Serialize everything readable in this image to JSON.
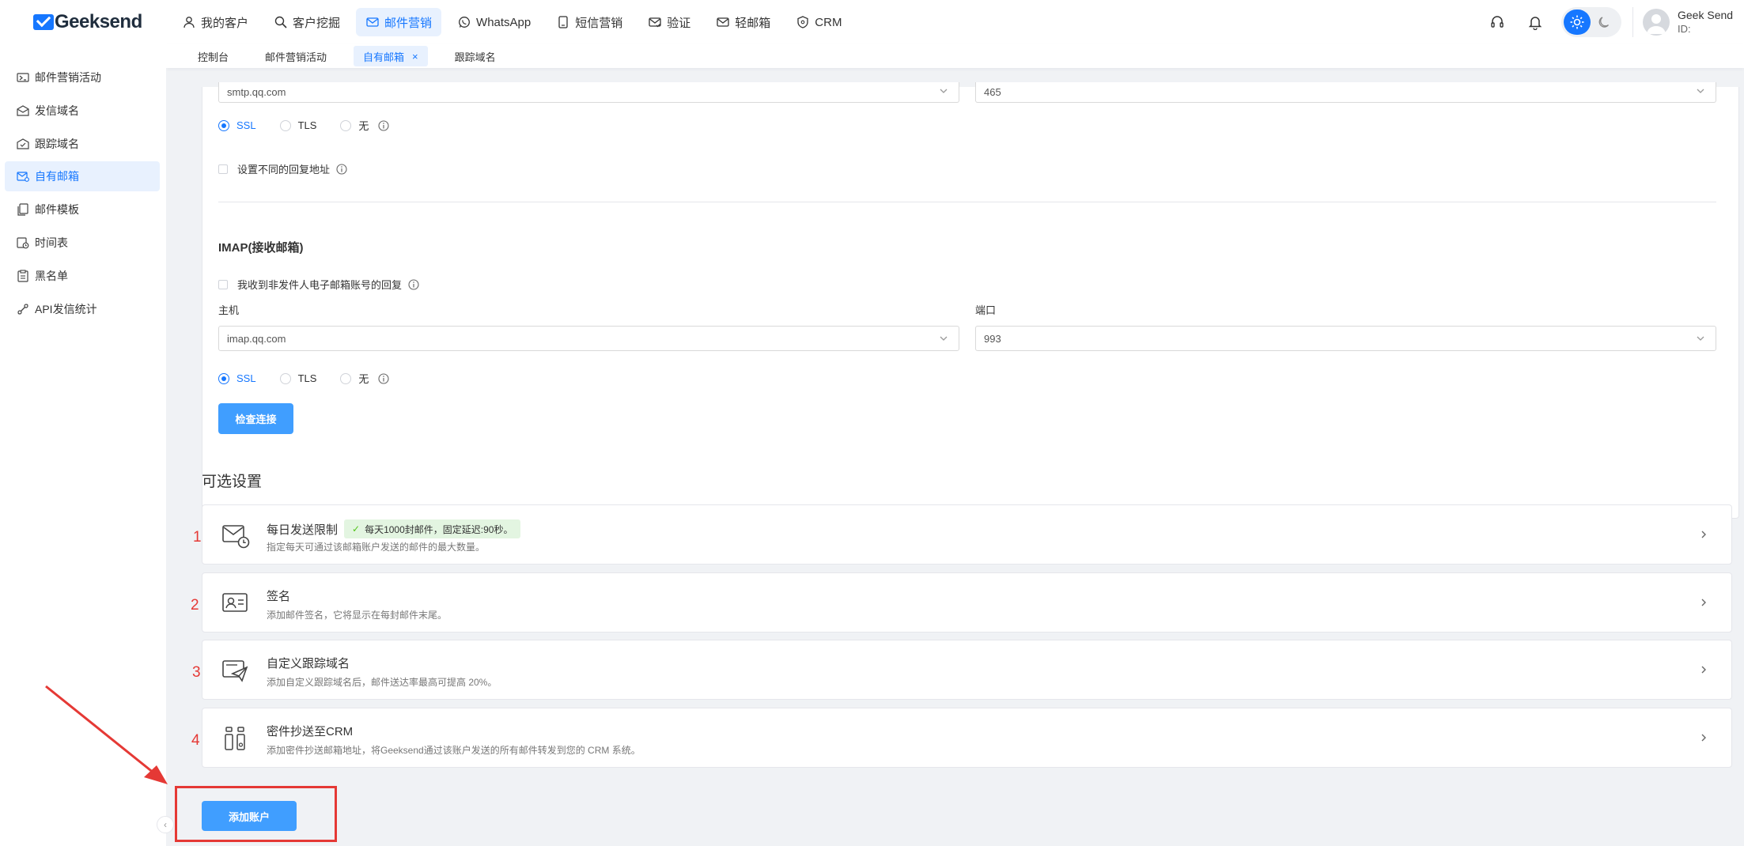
{
  "header": {
    "logo": "Geeksend",
    "nav": [
      {
        "label": "我的客户",
        "icon": "user-icon"
      },
      {
        "label": "客户挖掘",
        "icon": "search-icon"
      },
      {
        "label": "邮件营销",
        "icon": "mail-icon",
        "active": true
      },
      {
        "label": "WhatsApp",
        "icon": "whatsapp-icon"
      },
      {
        "label": "短信营销",
        "icon": "sms-icon"
      },
      {
        "label": "验证",
        "icon": "verify-icon"
      },
      {
        "label": "轻邮箱",
        "icon": "light-mail-icon"
      },
      {
        "label": "CRM",
        "icon": "shield-icon"
      }
    ],
    "user": {
      "name": "Geek Send",
      "id": "ID:"
    }
  },
  "subtabs": [
    {
      "label": "控制台"
    },
    {
      "label": "邮件营销活动"
    },
    {
      "label": "自有邮箱",
      "active": true,
      "close": "×"
    },
    {
      "label": "跟踪域名"
    }
  ],
  "sidebar": {
    "items": [
      {
        "label": "邮件营销活动",
        "icon": "mail-campaign-icon"
      },
      {
        "label": "发信域名",
        "icon": "send-domain-icon"
      },
      {
        "label": "跟踪域名",
        "icon": "track-domain-icon"
      },
      {
        "label": "自有邮箱",
        "icon": "own-mailbox-icon",
        "active": true
      },
      {
        "label": "邮件模板",
        "icon": "template-icon"
      },
      {
        "label": "时间表",
        "icon": "schedule-icon"
      },
      {
        "label": "黑名单",
        "icon": "blacklist-icon"
      },
      {
        "label": "API发信统计",
        "icon": "api-stats-icon"
      }
    ]
  },
  "smtp": {
    "host_value": "smtp.qq.com",
    "port_value": "465",
    "security_options": [
      "SSL",
      "TLS",
      "无"
    ],
    "selected": "SSL",
    "reply_checkbox": "设置不同的回复地址"
  },
  "imap": {
    "title": "IMAP(接收邮箱)",
    "reply_checkbox": "我收到非发件人电子邮箱账号的回复",
    "host_label": "主机",
    "port_label": "端口",
    "host_value": "imap.qq.com",
    "port_value": "993",
    "security_options": [
      "SSL",
      "TLS",
      "无"
    ],
    "selected": "SSL",
    "check_button": "检查连接"
  },
  "optional": {
    "title": "可选设置",
    "cards": [
      {
        "num": "1",
        "title": "每日发送限制",
        "badge": "每天1000封邮件，固定延迟:90秒。",
        "desc": "指定每天可通过该邮箱账户发送的邮件的最大数量。",
        "icon": "daily-limit-icon"
      },
      {
        "num": "2",
        "title": "签名",
        "desc": "添加邮件签名，它将显示在每封邮件末尾。",
        "icon": "signature-icon"
      },
      {
        "num": "3",
        "title": "自定义跟踪域名",
        "desc": "添加自定义跟踪域名后，邮件送达率最高可提高 20%。",
        "icon": "custom-tracking-icon"
      },
      {
        "num": "4",
        "title": "密件抄送至CRM",
        "desc": "添加密件抄送邮箱地址，将Geeksend通过该账户发送的所有邮件转发到您的 CRM 系统。",
        "icon": "bcc-crm-icon"
      }
    ]
  },
  "add_account_button": "添加账户",
  "colors": {
    "accent": "#1677ff",
    "button": "#409eff",
    "annotation": "#e53935"
  }
}
